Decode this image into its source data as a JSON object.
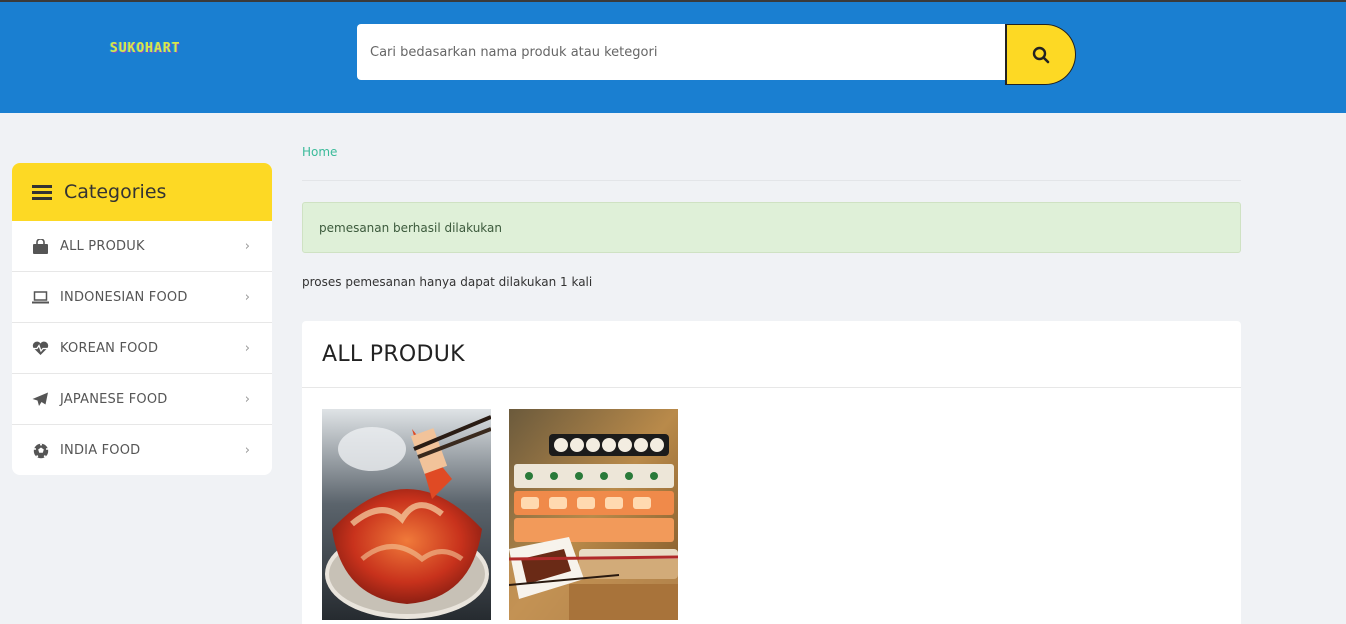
{
  "header": {
    "logo_text": "SUKOHART",
    "search": {
      "placeholder": "Cari bedasarkan nama produk atau ketegori",
      "value": ""
    },
    "search_button_icon": "search-icon",
    "colors": {
      "bar": "#1a7fd1",
      "accent": "#fdd924"
    }
  },
  "sidebar": {
    "title": "Categories",
    "title_icon": "menu-icon",
    "items": [
      {
        "label": "ALL PRODUK",
        "icon": "shopping-bag-icon"
      },
      {
        "label": "INDONESIAN FOOD",
        "icon": "laptop-icon"
      },
      {
        "label": "KOREAN FOOD",
        "icon": "heartbeat-icon"
      },
      {
        "label": "JAPANESE FOOD",
        "icon": "paper-plane-icon"
      },
      {
        "label": "INDIA FOOD",
        "icon": "soccer-ball-icon"
      }
    ]
  },
  "main": {
    "breadcrumb": "Home",
    "alert": "pemesanan berhasil dilakukan",
    "note": "proses pemesanan hanya dapat dilakukan 1 kali",
    "panel_title": "ALL PRODUK",
    "products": [
      {
        "image": "kimchi-bowl-photo"
      },
      {
        "image": "sushi-platter-photo"
      }
    ]
  }
}
